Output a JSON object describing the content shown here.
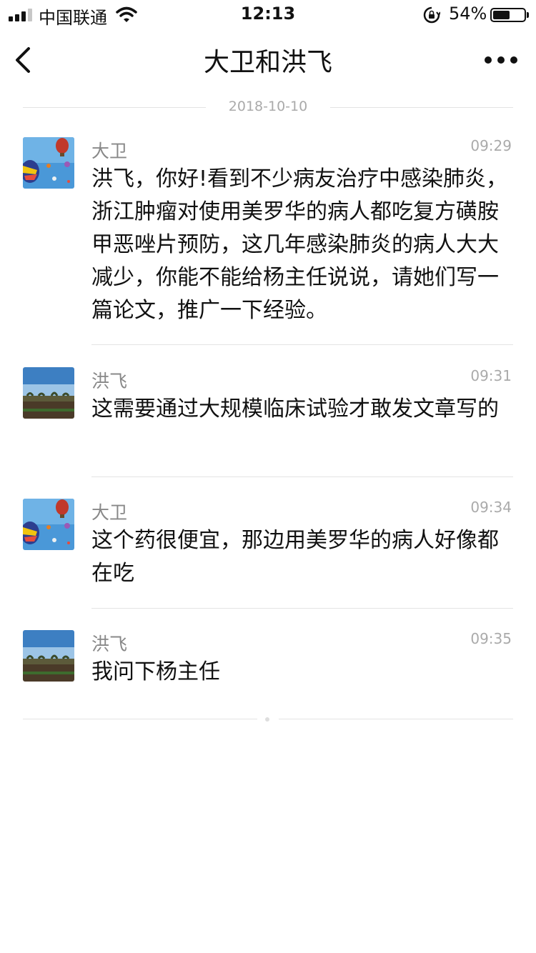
{
  "status_bar": {
    "carrier": "中国联通",
    "time": "12:13",
    "battery_percent": "54%",
    "battery_level": 0.54,
    "icons": [
      "signal-icon",
      "wifi-icon",
      "rotation-lock-icon",
      "battery-icon"
    ]
  },
  "nav": {
    "title": "大卫和洪飞",
    "back_icon": "chevron-left-icon",
    "more_icon": "more-dots-icon"
  },
  "date_label": "2018-10-10",
  "messages": [
    {
      "sender": "大卫",
      "time": "09:29",
      "avatar": "balloon-avatar",
      "text": "洪飞，你好!看到不少病友治疗中感染肺炎，浙江肿瘤对使用美罗华的病人都吃复方磺胺甲恶唑片预防，这几年感染肺炎的病人大大减少，你能不能给杨主任说说，请她们写一篇论文，推广一下经验。"
    },
    {
      "sender": "洪飞",
      "time": "09:31",
      "avatar": "landscape-avatar",
      "text": "这需要通过大规模临床试验才敢发文章写的"
    },
    {
      "sender": "大卫",
      "time": "09:34",
      "avatar": "balloon-avatar",
      "text": "这个药很便宜，那边用美罗华的病人好像都在吃"
    },
    {
      "sender": "洪飞",
      "time": "09:35",
      "avatar": "landscape-avatar",
      "text": "我问下杨主任"
    }
  ],
  "colors": {
    "background": "#ffffff",
    "text": "#111111",
    "secondary_text": "#888888",
    "divider": "#e3e3e3"
  }
}
